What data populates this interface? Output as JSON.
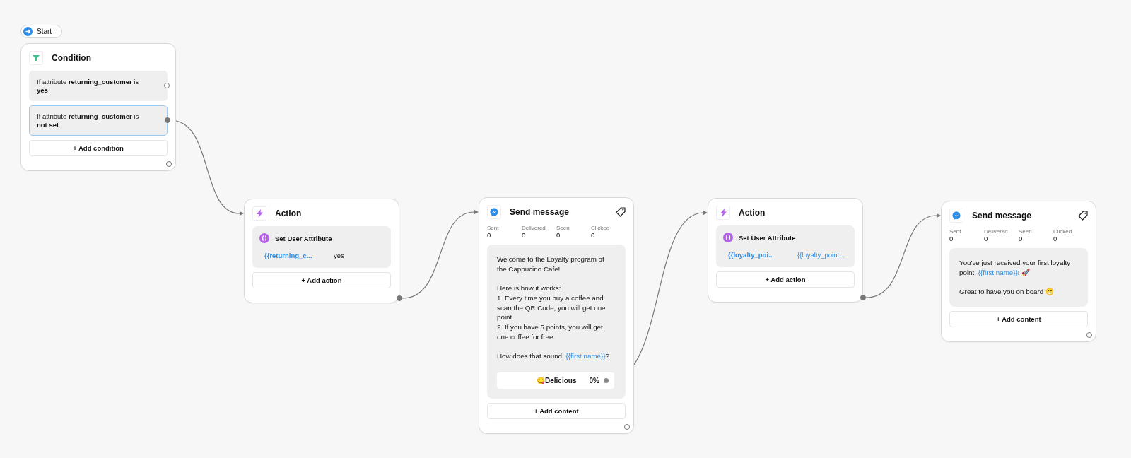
{
  "start": {
    "label": "Start"
  },
  "nodes": [
    {
      "kind": "condition",
      "title": "Condition",
      "conditions": [
        {
          "text": "If attribute **returning_customer** is **yes**",
          "selected": false,
          "connected": false
        },
        {
          "text": "If attribute **returning_customer** is **not set**",
          "selected": true,
          "connected": true
        }
      ],
      "add_label": "+ Add condition",
      "next_connected": false
    },
    {
      "kind": "action",
      "title": "Action",
      "actions": [
        {
          "title": "Set User Attribute",
          "attribute": "{{returning_c...",
          "value": "yes",
          "value_variable": false
        }
      ],
      "add_label": "+ Add action",
      "next_connected": true
    },
    {
      "kind": "message",
      "title": "Send message",
      "stats": [
        {
          "label": "Sent",
          "value": "0"
        },
        {
          "label": "Delivered",
          "value": "0"
        },
        {
          "label": "Seen",
          "value": "0"
        },
        {
          "label": "Clicked",
          "value": "0"
        }
      ],
      "paragraphs": [
        [
          {
            "text": "Welcome to the Loyalty program of the Cappucino Cafe!",
            "variable": false
          }
        ],
        [
          {
            "text": "Here is how it works:\n1. Every time you buy a coffee and scan the QR Code, you will get one point.\n2. If you have 5 points, you will get one coffee for free.",
            "variable": false
          }
        ],
        [
          {
            "text": "How does that sound, ",
            "variable": false
          },
          {
            "text": "{{first name}}",
            "variable": true
          },
          {
            "text": "?",
            "variable": false
          }
        ]
      ],
      "buttons": [
        {
          "label": "😋Delicious",
          "percent": "0%",
          "connected": true
        }
      ],
      "add_label": "+ Add content",
      "next_connected": false
    },
    {
      "kind": "action",
      "title": "Action",
      "actions": [
        {
          "title": "Set User Attribute",
          "attribute": "{{loyalty_poi...",
          "value": "{{loyalty_point...",
          "value_variable": true
        }
      ],
      "add_label": "+ Add action",
      "next_connected": true
    },
    {
      "kind": "message",
      "title": "Send message",
      "stats": [
        {
          "label": "Sent",
          "value": "0"
        },
        {
          "label": "Delivered",
          "value": "0"
        },
        {
          "label": "Seen",
          "value": "0"
        },
        {
          "label": "Clicked",
          "value": "0"
        }
      ],
      "paragraphs": [
        [
          {
            "text": "You've just received your first loyalty point, ",
            "variable": false
          },
          {
            "text": "{{first name}}",
            "variable": true
          },
          {
            "text": "! 🚀",
            "variable": false
          }
        ],
        [
          {
            "text": "Great to have you on board 😁",
            "variable": false
          }
        ]
      ],
      "add_label": "+ Add content",
      "next_connected": false
    }
  ]
}
